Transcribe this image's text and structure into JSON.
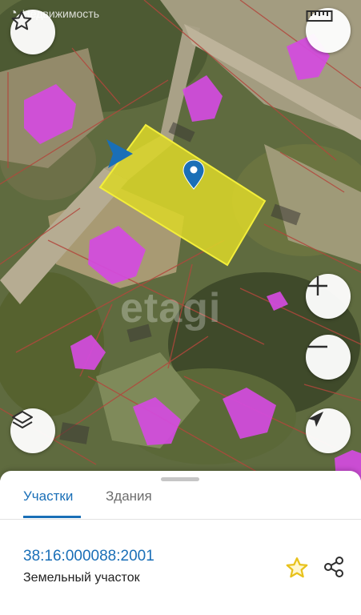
{
  "map": {
    "watermark_brand": "Недвижимость",
    "watermark_center": "etagi",
    "colors": {
      "parcel_fill": "#d9d52a",
      "parcel_border": "#f3ee3a",
      "building_fill": "#d44be0",
      "boundary_lines": "#b2473c",
      "marker": "#1a6fb7"
    },
    "controls": {
      "favorite_icon": "star-outline-icon",
      "ruler_icon": "ruler-icon",
      "zoom_in_icon": "plus-icon",
      "zoom_out_icon": "minus-icon",
      "layers_icon": "layers-icon",
      "location_icon": "navigation-arrow-icon"
    }
  },
  "sheet": {
    "tabs": [
      {
        "label": "Участки",
        "active": true
      },
      {
        "label": "Здания",
        "active": false
      }
    ],
    "parcel": {
      "number": "38:16:000088:2001",
      "type": "Земельный участок"
    },
    "icons": {
      "favorite": "star-icon",
      "share": "share-icon"
    },
    "accent_color": "#1a6fb7",
    "favorite_color": "#e8c21c"
  }
}
